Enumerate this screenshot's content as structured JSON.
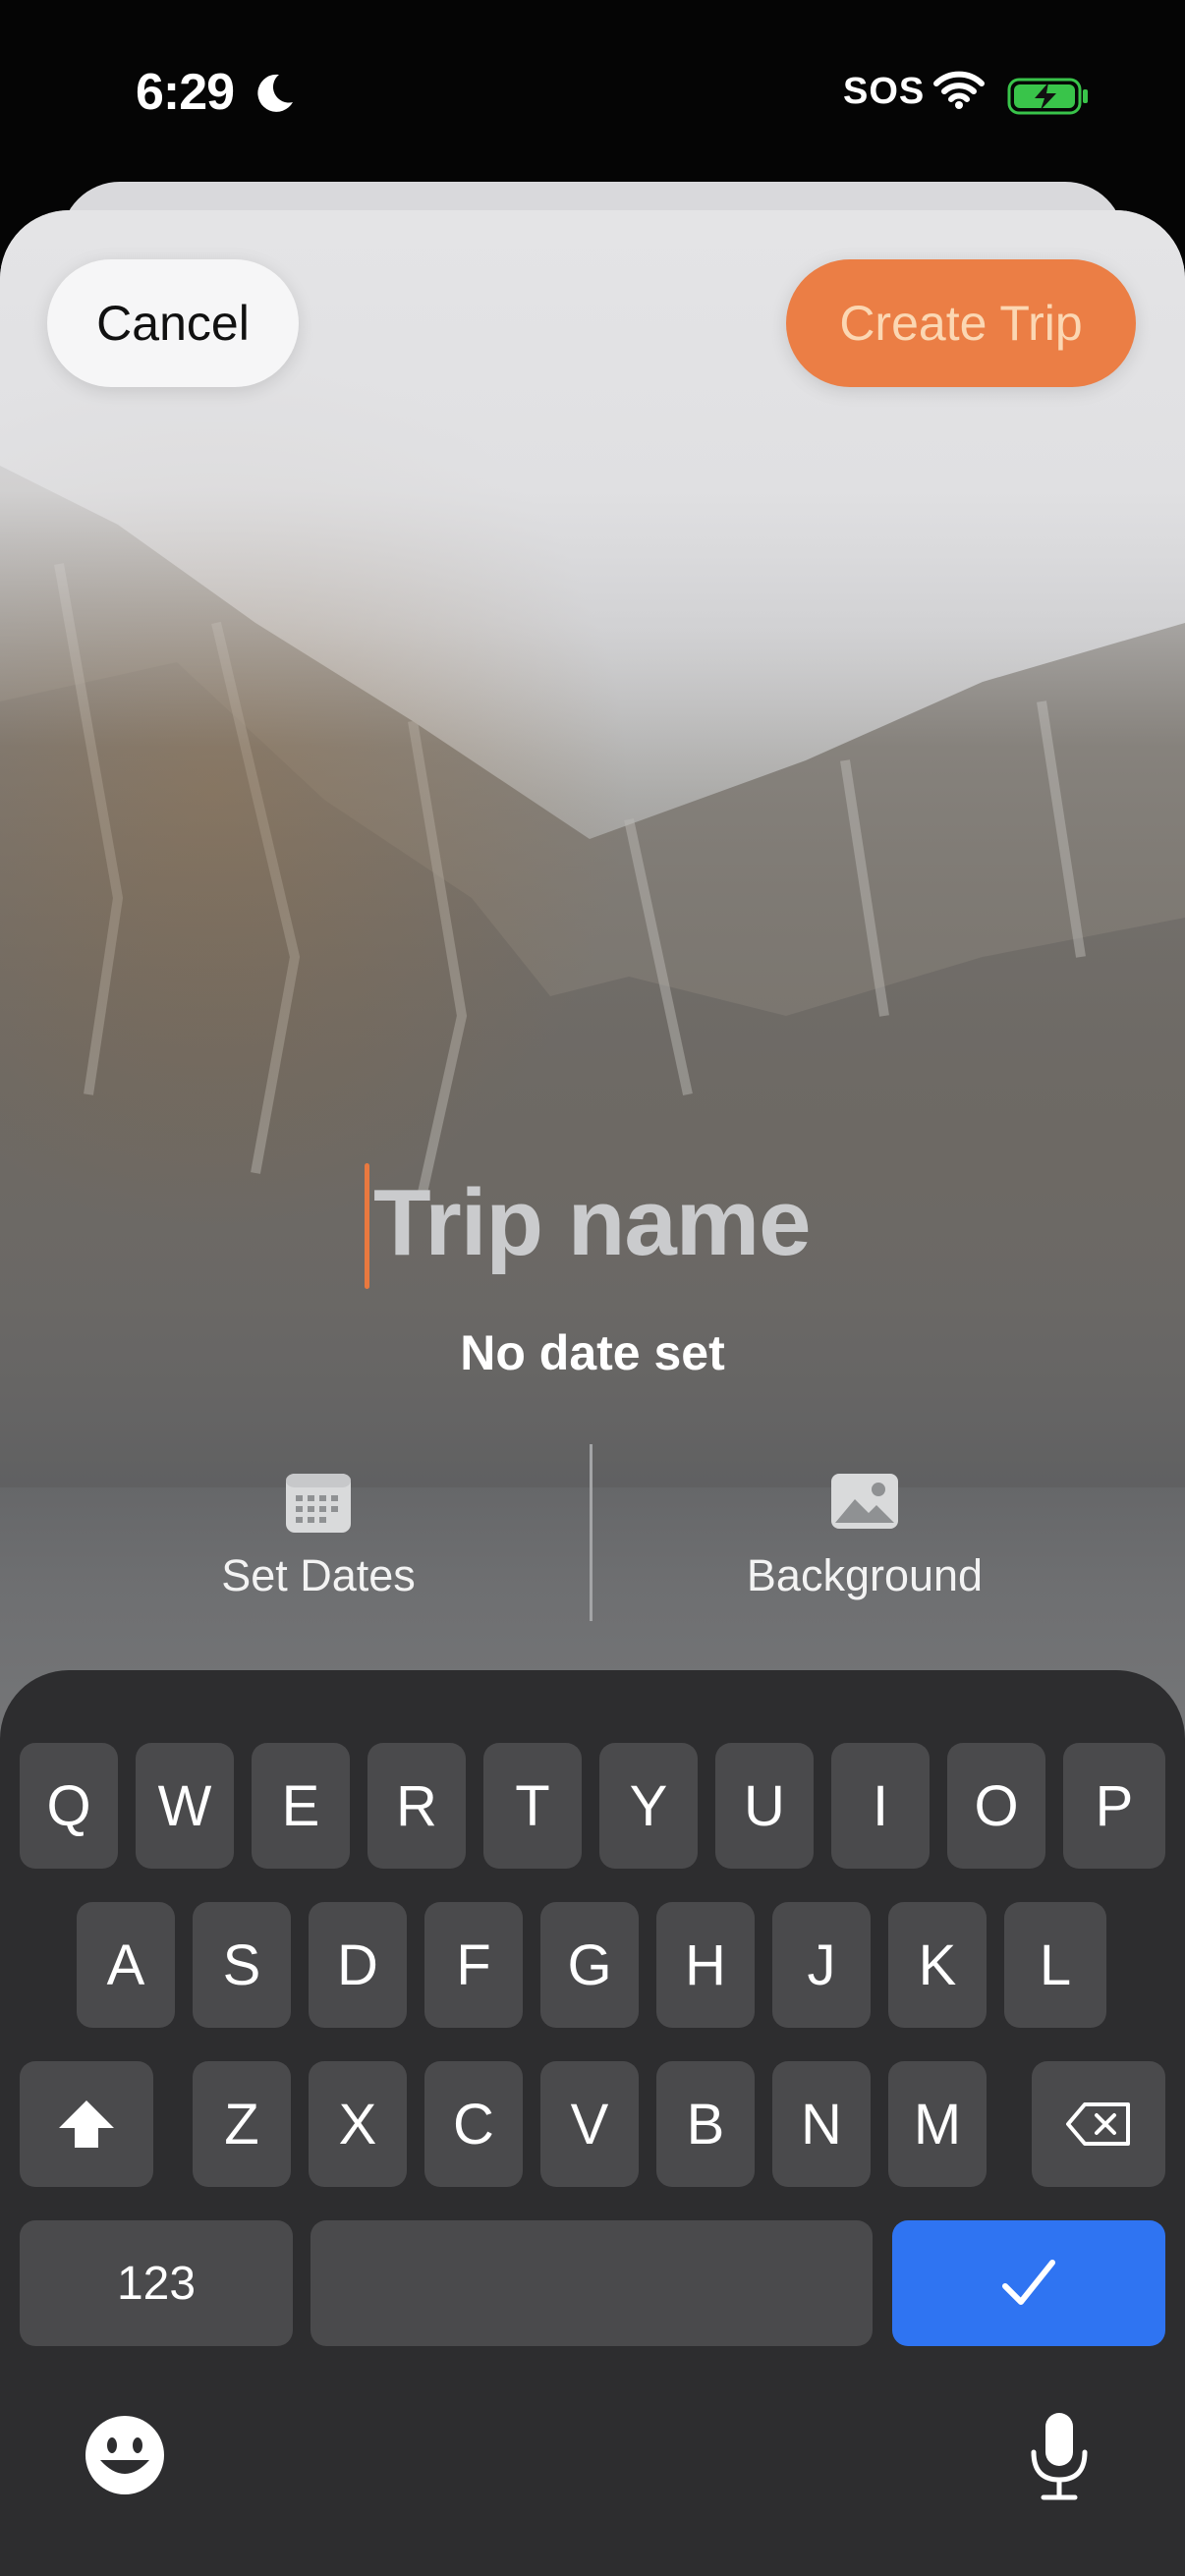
{
  "status_bar": {
    "time": "6:29",
    "carrier_status": "SOS",
    "icons": [
      "moon-icon",
      "wifi-icon",
      "battery-charging-icon"
    ],
    "battery_color": "#39c44a"
  },
  "header": {
    "cancel_label": "Cancel",
    "create_label": "Create Trip",
    "accent_color": "#eb7e45"
  },
  "trip": {
    "name_placeholder": "Trip name",
    "date_text": "No date set"
  },
  "actions": [
    {
      "label": "Set Dates",
      "icon": "calendar-icon"
    },
    {
      "label": "Background",
      "icon": "photo-icon"
    }
  ],
  "keyboard": {
    "row1": [
      "Q",
      "W",
      "E",
      "R",
      "T",
      "Y",
      "U",
      "I",
      "O",
      "P"
    ],
    "row2": [
      "A",
      "S",
      "D",
      "F",
      "G",
      "H",
      "J",
      "K",
      "L"
    ],
    "row3": [
      "Z",
      "X",
      "C",
      "V",
      "B",
      "N",
      "M"
    ],
    "numbers_label": "123",
    "icons": [
      "shift-icon",
      "delete-icon",
      "checkmark-icon",
      "emoji-icon",
      "microphone-icon"
    ],
    "done_color": "#2f74f2"
  }
}
